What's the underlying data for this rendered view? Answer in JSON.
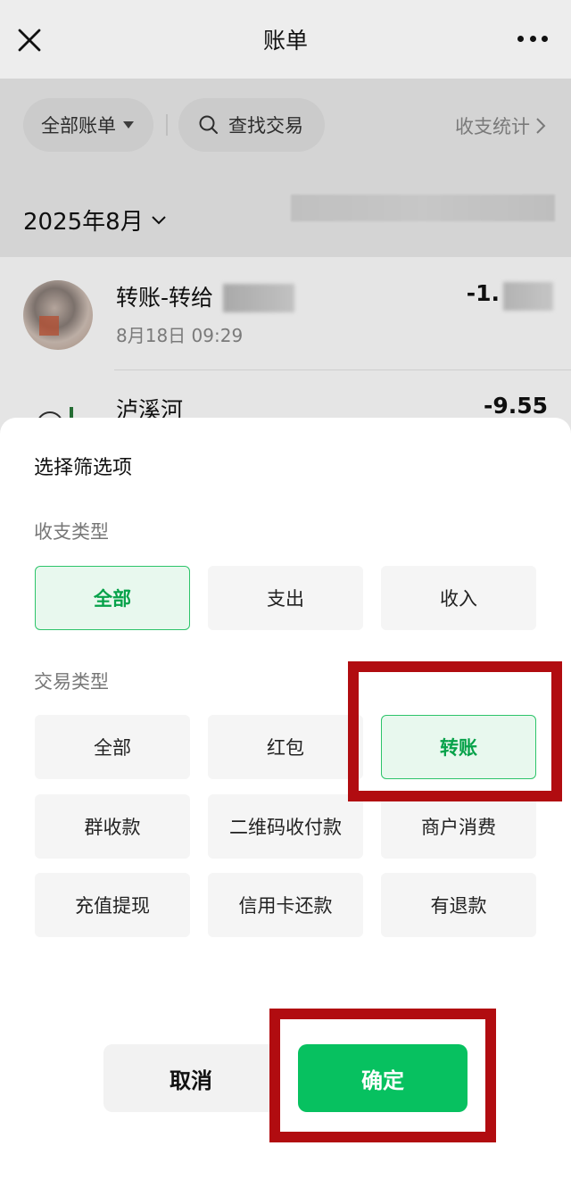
{
  "header": {
    "title": "账单"
  },
  "toolbar": {
    "bill_filter_label": "全部账单",
    "search_label": "查找交易",
    "stats_label": "收支统计"
  },
  "month": {
    "label": "2025年8月"
  },
  "transactions": [
    {
      "name": "转账-转给",
      "time": "8月18日 09:29",
      "amount": "-1."
    },
    {
      "name": "泸溪河",
      "amount": "-9.55"
    }
  ],
  "sheet": {
    "title": "选择筛选项",
    "income_section_label": "收支类型",
    "income_options": [
      "全部",
      "支出",
      "收入"
    ],
    "income_selected": "全部",
    "trade_section_label": "交易类型",
    "trade_options": [
      "全部",
      "红包",
      "转账",
      "群收款",
      "二维码收付款",
      "商户消费",
      "充值提现",
      "信用卡还款",
      "有退款"
    ],
    "trade_selected": "转账",
    "cancel_label": "取消",
    "confirm_label": "确定"
  },
  "colors": {
    "accent": "#07c160",
    "selected_text": "#07a24a",
    "selected_bg": "#e8f8ee",
    "highlight_box": "#b10c10"
  }
}
